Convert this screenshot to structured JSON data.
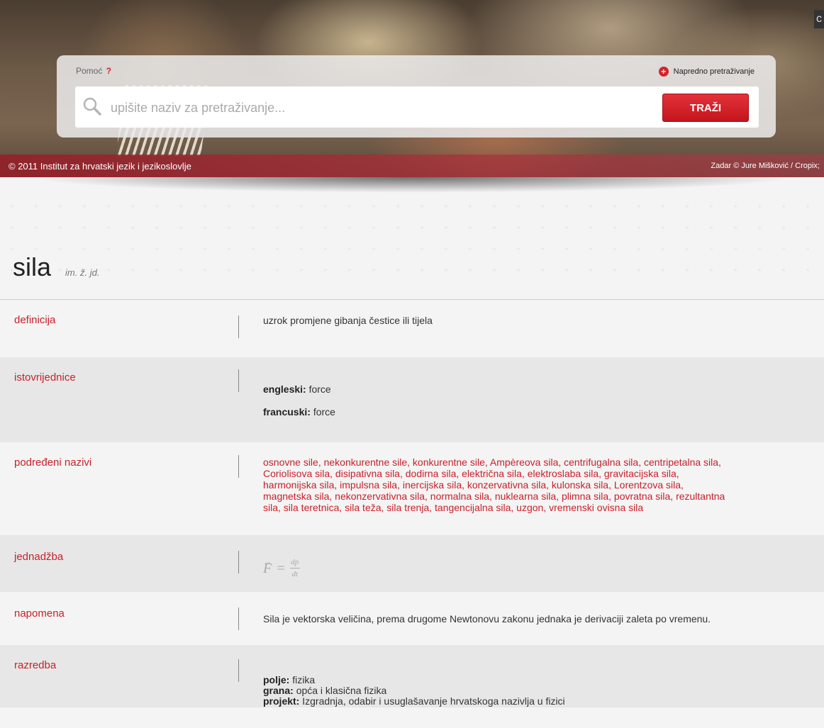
{
  "header": {
    "help_label": "Pomoć",
    "help_mark": "?",
    "advanced_search_label": "Napredno pretraživanje",
    "search_placeholder": "upišite naziv za pretraživanje...",
    "search_button_label": "TRAŽI",
    "copyright_text": "© 2011 Institut za hrvatski jezik i jezikoslovlje",
    "photo_credit": "Zadar © Jure Mišković / Cropix;"
  },
  "term": {
    "word": "sila",
    "grammar": "im. ž. jd."
  },
  "rows": {
    "definition": {
      "label": "definicija",
      "text": "uzrok promjene gibanja čestice ili tijela"
    },
    "equivalents": {
      "label": "istovrijednice",
      "items": [
        {
          "lang": "engleski:",
          "value": "force"
        },
        {
          "lang": "francuski:",
          "value": "force"
        }
      ]
    },
    "subordinate": {
      "label": "podređeni nazivi",
      "lines": [
        "osnovne sile, nekonkurentne sile, konkurentne sile, Ampèreova sila, centrifugalna sila, centripetalna sila,",
        "Coriolisova sila, disipativna sila, dodirna sila, električna sila, elektroslaba sila, gravitacijska sila,",
        "harmonijska sila, impulsna sila, inercijska sila, konzervativna sila, kulonska sila, Lorentzova sila,",
        "magnetska sila, nekonzervativna sila, normalna sila, nuklearna sila, plimna sila, povratna sila, rezultantna",
        "sila, sila teretnica, sila teža, sila trenja, tangencijalna sila, uzgon, vremenski ovisna sila"
      ]
    },
    "equation": {
      "label": "jednadžba",
      "lhs": "F",
      "equals": "=",
      "numerator": "dp",
      "denominator": "dt",
      "arrow": "→"
    },
    "note": {
      "label": "napomena",
      "text": "Sila je vektorska veličina, prema drugome Newtonovu zakonu jednaka je derivaciji zaleta po vremenu."
    },
    "classification": {
      "label": "razredba",
      "items": [
        {
          "key": "polje:",
          "value": "fizika"
        },
        {
          "key": "grana:",
          "value": "opća i klasična fizika"
        },
        {
          "key": "projekt:",
          "value": "Izgradnja, odabir i usuglašavanje hrvatskoga nazivlja u fizici"
        }
      ]
    }
  }
}
